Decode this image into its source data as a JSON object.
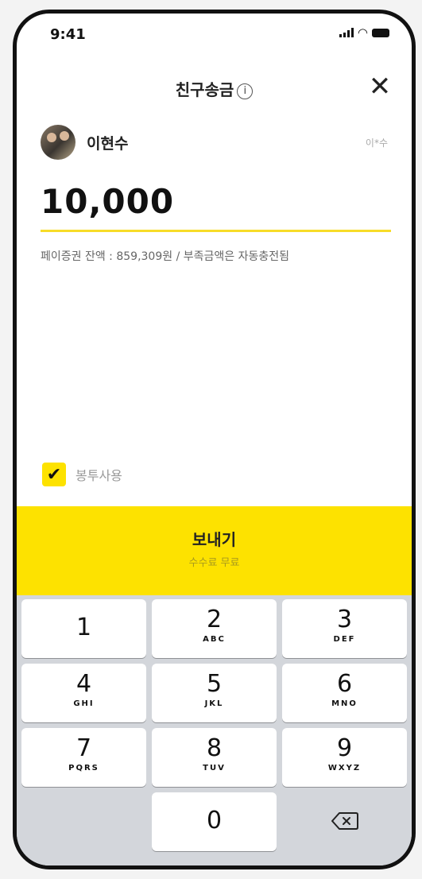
{
  "status_bar": {
    "time": "9:41"
  },
  "header": {
    "title": "친구송금",
    "info_glyph": "i",
    "close_glyph": "✕"
  },
  "recipient": {
    "name": "이현수",
    "masked_name": "이*수"
  },
  "amount": {
    "value": "10,000"
  },
  "balance_note": "페이증권 잔액 : 859,309원 / 부족금액은 자동충전됨",
  "envelope": {
    "checked": true,
    "label": "봉투사용",
    "check_glyph": "✔"
  },
  "send_button": {
    "label": "보내기",
    "sub_label": "수수료 무료"
  },
  "keypad": {
    "keys": [
      {
        "digit": "1",
        "letters": ""
      },
      {
        "digit": "2",
        "letters": "ABC"
      },
      {
        "digit": "3",
        "letters": "DEF"
      },
      {
        "digit": "4",
        "letters": "GHI"
      },
      {
        "digit": "5",
        "letters": "JKL"
      },
      {
        "digit": "6",
        "letters": "MNO"
      },
      {
        "digit": "7",
        "letters": "PQRS"
      },
      {
        "digit": "8",
        "letters": "TUV"
      },
      {
        "digit": "9",
        "letters": "WXYZ"
      },
      {
        "digit": "0",
        "letters": ""
      }
    ]
  },
  "colors": {
    "accent": "#fde200",
    "keypad_bg": "#d3d6db"
  }
}
